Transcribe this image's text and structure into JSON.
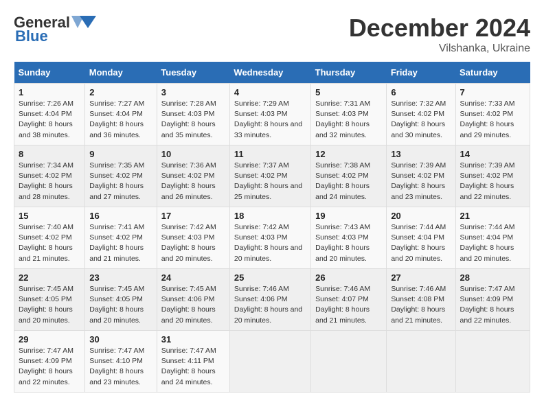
{
  "logo": {
    "line1": "General",
    "line2": "Blue"
  },
  "title": "December 2024",
  "subtitle": "Vilshanka, Ukraine",
  "days_header": [
    "Sunday",
    "Monday",
    "Tuesday",
    "Wednesday",
    "Thursday",
    "Friday",
    "Saturday"
  ],
  "weeks": [
    [
      {
        "num": "1",
        "sunrise": "7:26 AM",
        "sunset": "4:04 PM",
        "daylight": "8 hours and 38 minutes."
      },
      {
        "num": "2",
        "sunrise": "7:27 AM",
        "sunset": "4:04 PM",
        "daylight": "8 hours and 36 minutes."
      },
      {
        "num": "3",
        "sunrise": "7:28 AM",
        "sunset": "4:03 PM",
        "daylight": "8 hours and 35 minutes."
      },
      {
        "num": "4",
        "sunrise": "7:29 AM",
        "sunset": "4:03 PM",
        "daylight": "8 hours and 33 minutes."
      },
      {
        "num": "5",
        "sunrise": "7:31 AM",
        "sunset": "4:03 PM",
        "daylight": "8 hours and 32 minutes."
      },
      {
        "num": "6",
        "sunrise": "7:32 AM",
        "sunset": "4:02 PM",
        "daylight": "8 hours and 30 minutes."
      },
      {
        "num": "7",
        "sunrise": "7:33 AM",
        "sunset": "4:02 PM",
        "daylight": "8 hours and 29 minutes."
      }
    ],
    [
      {
        "num": "8",
        "sunrise": "7:34 AM",
        "sunset": "4:02 PM",
        "daylight": "8 hours and 28 minutes."
      },
      {
        "num": "9",
        "sunrise": "7:35 AM",
        "sunset": "4:02 PM",
        "daylight": "8 hours and 27 minutes."
      },
      {
        "num": "10",
        "sunrise": "7:36 AM",
        "sunset": "4:02 PM",
        "daylight": "8 hours and 26 minutes."
      },
      {
        "num": "11",
        "sunrise": "7:37 AM",
        "sunset": "4:02 PM",
        "daylight": "8 hours and 25 minutes."
      },
      {
        "num": "12",
        "sunrise": "7:38 AM",
        "sunset": "4:02 PM",
        "daylight": "8 hours and 24 minutes."
      },
      {
        "num": "13",
        "sunrise": "7:39 AM",
        "sunset": "4:02 PM",
        "daylight": "8 hours and 23 minutes."
      },
      {
        "num": "14",
        "sunrise": "7:39 AM",
        "sunset": "4:02 PM",
        "daylight": "8 hours and 22 minutes."
      }
    ],
    [
      {
        "num": "15",
        "sunrise": "7:40 AM",
        "sunset": "4:02 PM",
        "daylight": "8 hours and 21 minutes."
      },
      {
        "num": "16",
        "sunrise": "7:41 AM",
        "sunset": "4:02 PM",
        "daylight": "8 hours and 21 minutes."
      },
      {
        "num": "17",
        "sunrise": "7:42 AM",
        "sunset": "4:03 PM",
        "daylight": "8 hours and 20 minutes."
      },
      {
        "num": "18",
        "sunrise": "7:42 AM",
        "sunset": "4:03 PM",
        "daylight": "8 hours and 20 minutes."
      },
      {
        "num": "19",
        "sunrise": "7:43 AM",
        "sunset": "4:03 PM",
        "daylight": "8 hours and 20 minutes."
      },
      {
        "num": "20",
        "sunrise": "7:44 AM",
        "sunset": "4:04 PM",
        "daylight": "8 hours and 20 minutes."
      },
      {
        "num": "21",
        "sunrise": "7:44 AM",
        "sunset": "4:04 PM",
        "daylight": "8 hours and 20 minutes."
      }
    ],
    [
      {
        "num": "22",
        "sunrise": "7:45 AM",
        "sunset": "4:05 PM",
        "daylight": "8 hours and 20 minutes."
      },
      {
        "num": "23",
        "sunrise": "7:45 AM",
        "sunset": "4:05 PM",
        "daylight": "8 hours and 20 minutes."
      },
      {
        "num": "24",
        "sunrise": "7:45 AM",
        "sunset": "4:06 PM",
        "daylight": "8 hours and 20 minutes."
      },
      {
        "num": "25",
        "sunrise": "7:46 AM",
        "sunset": "4:06 PM",
        "daylight": "8 hours and 20 minutes."
      },
      {
        "num": "26",
        "sunrise": "7:46 AM",
        "sunset": "4:07 PM",
        "daylight": "8 hours and 21 minutes."
      },
      {
        "num": "27",
        "sunrise": "7:46 AM",
        "sunset": "4:08 PM",
        "daylight": "8 hours and 21 minutes."
      },
      {
        "num": "28",
        "sunrise": "7:47 AM",
        "sunset": "4:09 PM",
        "daylight": "8 hours and 22 minutes."
      }
    ],
    [
      {
        "num": "29",
        "sunrise": "7:47 AM",
        "sunset": "4:09 PM",
        "daylight": "8 hours and 22 minutes."
      },
      {
        "num": "30",
        "sunrise": "7:47 AM",
        "sunset": "4:10 PM",
        "daylight": "8 hours and 23 minutes."
      },
      {
        "num": "31",
        "sunrise": "7:47 AM",
        "sunset": "4:11 PM",
        "daylight": "8 hours and 24 minutes."
      },
      null,
      null,
      null,
      null
    ]
  ],
  "labels": {
    "sunrise": "Sunrise:",
    "sunset": "Sunset:",
    "daylight": "Daylight:"
  }
}
